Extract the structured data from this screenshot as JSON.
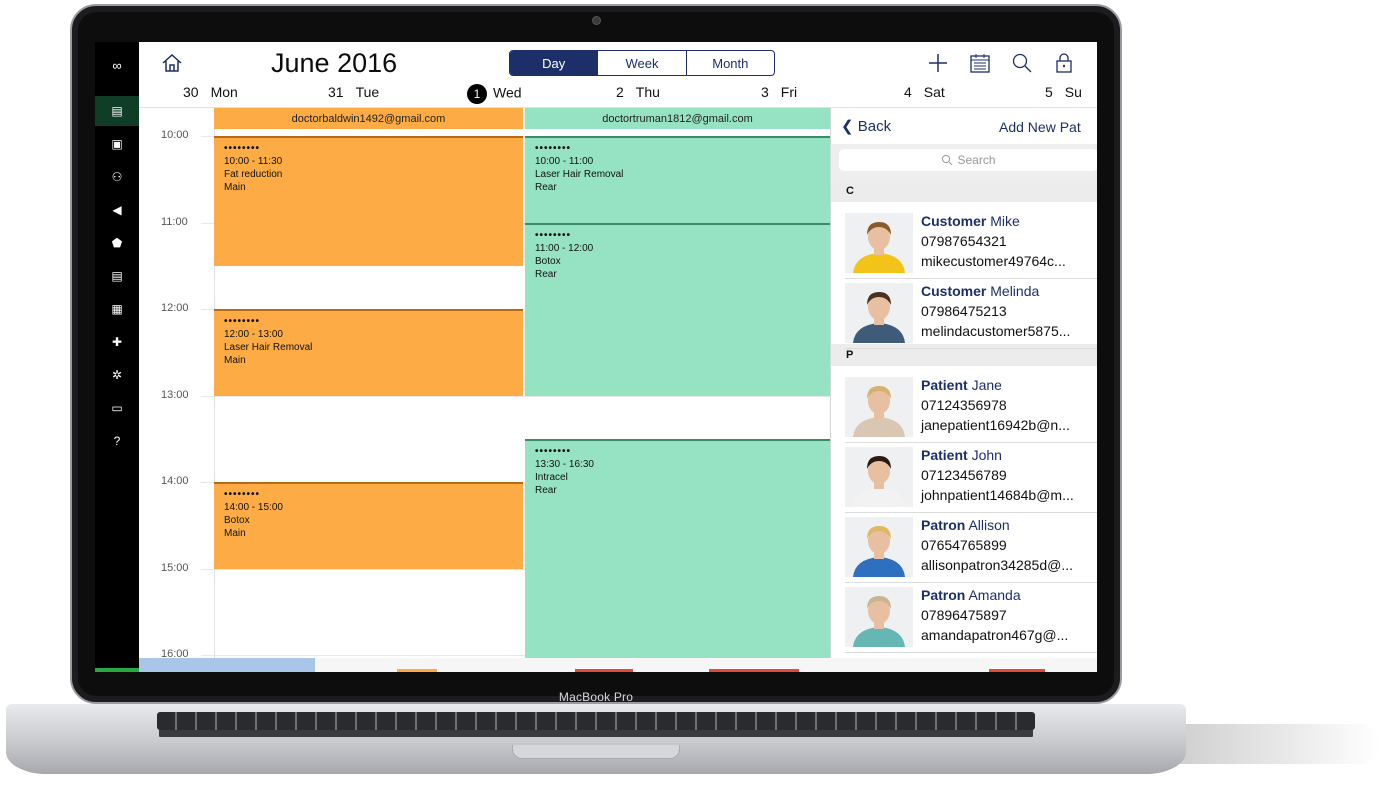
{
  "laptop": {
    "brand": "MacBook Pro"
  },
  "sidebar": {
    "logo": "∞",
    "items": [
      {
        "icon": "calendar-icon",
        "glyph": "▤",
        "active": true
      },
      {
        "icon": "calendar-day-icon",
        "glyph": "▣"
      },
      {
        "icon": "users-icon",
        "glyph": "⚇"
      },
      {
        "icon": "megaphone-icon",
        "glyph": "◀"
      },
      {
        "icon": "basket-icon",
        "glyph": "⬟"
      },
      {
        "icon": "document-icon",
        "glyph": "▤"
      },
      {
        "icon": "chart-icon",
        "glyph": "▦"
      },
      {
        "icon": "puzzle-icon",
        "glyph": "✚"
      },
      {
        "icon": "gear-icon",
        "glyph": "✲"
      },
      {
        "icon": "message-icon",
        "glyph": "▭"
      },
      {
        "icon": "help-icon",
        "glyph": "?"
      }
    ]
  },
  "header": {
    "month": "June",
    "year": "2016",
    "views": [
      "Day",
      "Week",
      "Month"
    ],
    "active_view": "Day",
    "days": [
      {
        "num": "30",
        "name": "Mon"
      },
      {
        "num": "31",
        "name": "Tue"
      },
      {
        "num": "1",
        "name": "Wed",
        "today": true
      },
      {
        "num": "2",
        "name": "Thu"
      },
      {
        "num": "3",
        "name": "Fri"
      },
      {
        "num": "4",
        "name": "Sat"
      },
      {
        "num": "5",
        "name": "Su"
      }
    ]
  },
  "calendar": {
    "times": [
      "10:00",
      "11:00",
      "12:00",
      "13:00",
      "14:00",
      "15:00",
      "16:00"
    ],
    "columns": [
      {
        "email": "doctorbaldwin1492@gmail.com",
        "color": "#fdac45"
      },
      {
        "email": "doctortruman1812@gmail.com",
        "color": "#96e3c4"
      }
    ],
    "appointments": [
      {
        "dots": "••••••••",
        "time": "10:00 - 11:30",
        "treatment": "Fat reduction",
        "room": "Main"
      },
      {
        "dots": "••••••••",
        "time": "12:00 - 13:00",
        "treatment": "Laser Hair Removal",
        "room": "Main"
      },
      {
        "dots": "••••••••",
        "time": "14:00 - 15:00",
        "treatment": "Botox",
        "room": "Main"
      },
      {
        "dots": "••••••••",
        "time": "10:00 - 11:00",
        "treatment": "Laser Hair Removal",
        "room": "Rear"
      },
      {
        "dots": "••••••••",
        "time": "11:00 - 12:00",
        "treatment": "Botox",
        "room": "Rear"
      },
      {
        "dots": "••••••••",
        "time": "13:30 - 16:30",
        "treatment": "Intracel",
        "room": "Rear"
      }
    ]
  },
  "panel": {
    "back": "Back",
    "add_new": "Add New Pat",
    "search_placeholder": "Search",
    "sections": [
      "C",
      "P"
    ],
    "contacts": [
      {
        "first": "Customer",
        "last": "Mike",
        "phone": "07987654321",
        "email": "mikecustomer49764c...",
        "shirt": "#f2c318",
        "hair": "#8a5a2b"
      },
      {
        "first": "Customer",
        "last": "Melinda",
        "phone": "07986475213",
        "email": "melindacustomer5875...",
        "shirt": "#3f5b7a",
        "hair": "#4a3222"
      },
      {
        "first": "Patient",
        "last": "Jane",
        "phone": "07124356978",
        "email": "janepatient16942b@n...",
        "shirt": "#d9c7b4",
        "hair": "#d6b26f"
      },
      {
        "first": "Patient",
        "last": "John",
        "phone": "07123456789",
        "email": "johnpatient14684b@m...",
        "shirt": "#f2f2f2",
        "hair": "#2a1a10"
      },
      {
        "first": "Patron",
        "last": "Allison",
        "phone": "07654765899",
        "email": "allisonpatron34285d@...",
        "shirt": "#2f6fc0",
        "hair": "#e0b860"
      },
      {
        "first": "Patron",
        "last": "Amanda",
        "phone": "07896475897",
        "email": "amandapatron467g@...",
        "shirt": "#66b7b4",
        "hair": "#c9b690"
      }
    ]
  }
}
